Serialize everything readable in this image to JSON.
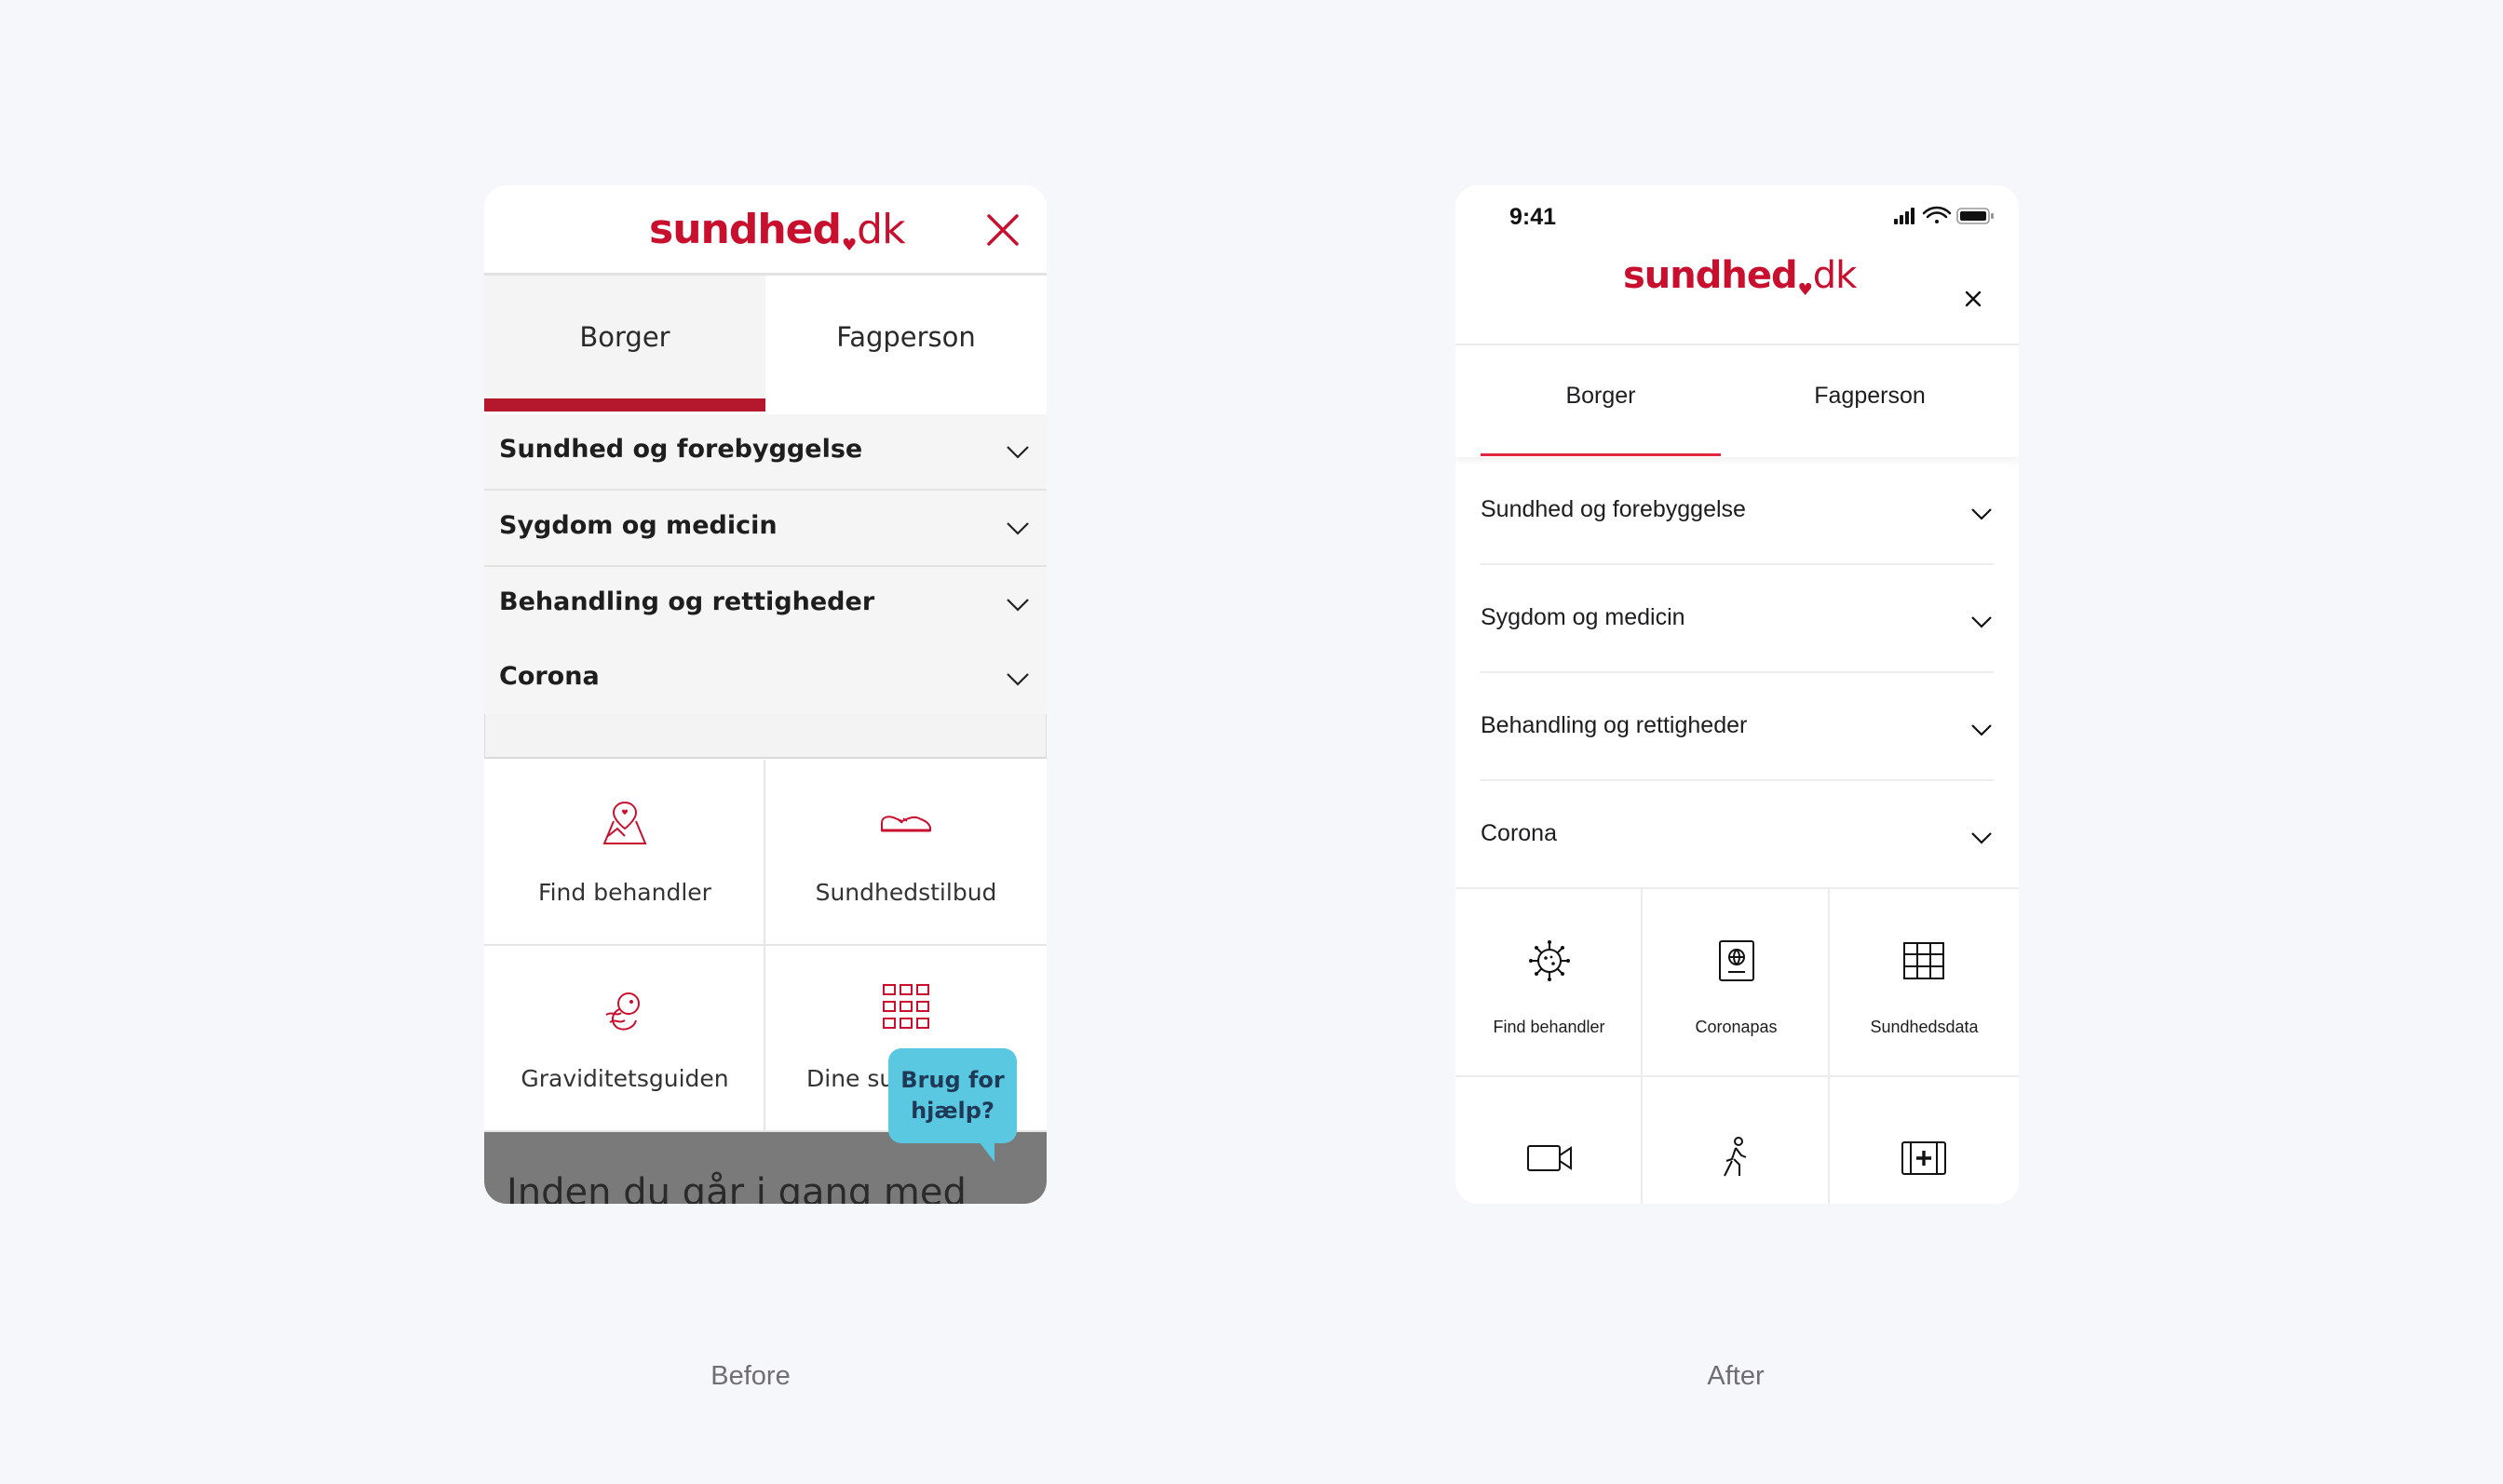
{
  "captions": {
    "before": "Before",
    "after": "After"
  },
  "brand": {
    "logo_main": "sundhed",
    "logo_tld": "dk",
    "color": "#c8102e"
  },
  "before": {
    "tabs": [
      {
        "label": "Borger",
        "active": true
      },
      {
        "label": "Fagperson",
        "active": false
      }
    ],
    "accordion": [
      {
        "label": "Sundhed og forebyggelse"
      },
      {
        "label": "Sygdom og medicin"
      },
      {
        "label": "Behandling og rettigheder"
      },
      {
        "label": "Corona"
      }
    ],
    "tiles": [
      {
        "label": "Find behandler",
        "icon": "map-pin-icon"
      },
      {
        "label": "Sundhedstilbud",
        "icon": "shoe-icon"
      },
      {
        "label": "Graviditetsguiden",
        "icon": "fetus-icon"
      },
      {
        "label": "Dine sun",
        "icon": "grid-icon"
      }
    ],
    "help_bubble": "Brug for\nhjælp?",
    "footer_text": "Inden du går i gang med",
    "accent_color": "#b5172c",
    "help_color": "#5bc8e2"
  },
  "after": {
    "status_time": "9:41",
    "tabs": [
      {
        "label": "Borger",
        "active": true
      },
      {
        "label": "Fagperson",
        "active": false
      }
    ],
    "accordion": [
      {
        "label": "Sundhed og forebyggelse"
      },
      {
        "label": "Sygdom og medicin"
      },
      {
        "label": "Behandling og rettigheder"
      },
      {
        "label": "Corona"
      }
    ],
    "tiles": [
      {
        "label": "Find behandler",
        "icon": "virus-icon"
      },
      {
        "label": "Coronapas",
        "icon": "passport-icon"
      },
      {
        "label": "Sundhedsdata",
        "icon": "table-icon"
      },
      {
        "label": "",
        "icon": "video-icon"
      },
      {
        "label": "",
        "icon": "walking-person-icon"
      },
      {
        "label": "",
        "icon": "medical-kit-icon"
      }
    ],
    "accent_color": "#e2263f"
  }
}
